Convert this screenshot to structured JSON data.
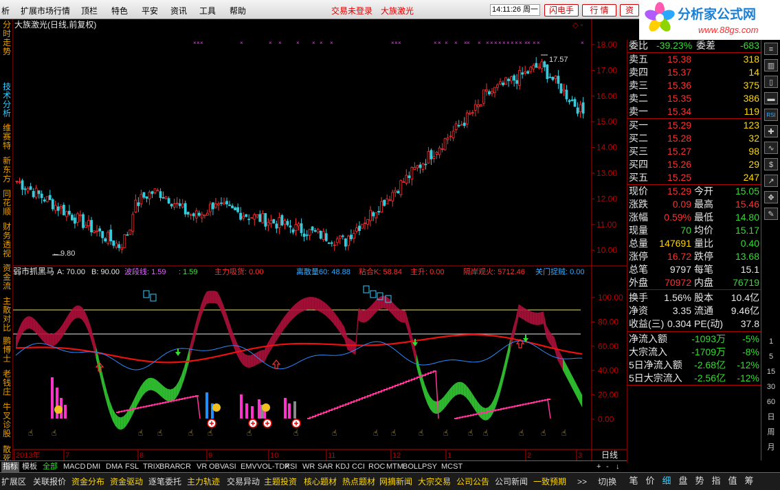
{
  "menu": {
    "items": [
      "析",
      "扩展市场行情",
      "顶栏",
      "特色",
      "平安",
      "资讯",
      "工具",
      "帮助"
    ],
    "status_left": "交易未登录",
    "status_right": "大族激光",
    "clock": "14:11:26 周一",
    "btn_flash": "闪电手",
    "btn_quote": "行 情",
    "btn_trade": "资"
  },
  "logo": {
    "title": "分析家公式网",
    "url": "www.88gs.com"
  },
  "left_tabs": [
    "分时走势",
    "技术分析",
    "维赛特",
    "新东方",
    "同花顺",
    "财务透视",
    "资金流",
    "主散对比",
    "鹏博士",
    "老钱庄",
    "牛叉诊股",
    "散死队"
  ],
  "chart": {
    "title": "大族激光(日线,前复权)",
    "max_label": "17.57",
    "min_label": "9.80",
    "price_ticks": [
      "18.00",
      "17.00",
      "16.00",
      "15.00",
      "14.00",
      "13.00",
      "12.00",
      "11.00",
      "10.00"
    ],
    "ind_ticks": [
      "100.00",
      "80.00",
      "60.00",
      "40.00",
      "20.00",
      "0.00"
    ],
    "dates": [
      "2013年",
      "7",
      "8",
      "9",
      "10",
      "11",
      "12",
      "1",
      "2",
      "3"
    ],
    "period": "日线",
    "ind_name": "弱市抓黑马",
    "ind_a": "A: 70.00",
    "ind_b": "B: 90.00",
    "ind_bd": "波段线: 1.59",
    "ind_v2": ": 1.59",
    "ind_zl": "主力吸货: 0.00",
    "ind_lsl": "离散量60: 48.88",
    "ind_nhk": "粘合K: 58.84",
    "ind_zs": "主升: 0.00",
    "ind_gag": "隔岸观火: 5712.46",
    "ind_gm": "关门捉贼: 0.00"
  },
  "quote": {
    "wb_label": "委比",
    "wb_val": "-39.23%",
    "wc_label": "委差",
    "wc_val": "-683",
    "asks": [
      {
        "label": "卖五",
        "price": "15.38",
        "vol": "318"
      },
      {
        "label": "卖四",
        "price": "15.37",
        "vol": "14"
      },
      {
        "label": "卖三",
        "price": "15.36",
        "vol": "375"
      },
      {
        "label": "卖二",
        "price": "15.35",
        "vol": "386"
      },
      {
        "label": "卖一",
        "price": "15.34",
        "vol": "119"
      }
    ],
    "bids": [
      {
        "label": "买一",
        "price": "15.29",
        "vol": "123"
      },
      {
        "label": "买二",
        "price": "15.28",
        "vol": "32"
      },
      {
        "label": "买三",
        "price": "15.27",
        "vol": "98"
      },
      {
        "label": "买四",
        "price": "15.26",
        "vol": "29"
      },
      {
        "label": "买五",
        "price": "15.25",
        "vol": "247"
      }
    ],
    "stats": [
      {
        "l1": "现价",
        "v1": "15.29",
        "c1": "#ff3030",
        "l2": "今开",
        "v2": "15.05",
        "c2": "#33dd33"
      },
      {
        "l1": "涨跌",
        "v1": "0.09",
        "c1": "#ff3030",
        "l2": "最高",
        "v2": "15.46",
        "c2": "#ff3030"
      },
      {
        "l1": "涨幅",
        "v1": "0.59%",
        "c1": "#ff3030",
        "l2": "最低",
        "v2": "14.80",
        "c2": "#33dd33"
      },
      {
        "l1": "现量",
        "v1": "70",
        "c1": "#33dd33",
        "l2": "均价",
        "v2": "15.17",
        "c2": "#33dd33"
      },
      {
        "l1": "总量",
        "v1": "147691",
        "c1": "#ffd800",
        "l2": "量比",
        "v2": "0.40",
        "c2": "#33dd33"
      },
      {
        "l1": "涨停",
        "v1": "16.72",
        "c1": "#ff3030",
        "l2": "跌停",
        "v2": "13.68",
        "c2": "#33dd33"
      },
      {
        "l1": "总笔",
        "v1": "9797",
        "c1": "#e8e8e8",
        "l2": "每笔",
        "v2": "15.1",
        "c2": "#e8e8e8"
      },
      {
        "l1": "外盘",
        "v1": "70972",
        "c1": "#ff3030",
        "l2": "内盘",
        "v2": "76719",
        "c2": "#33dd33"
      }
    ],
    "fund": [
      {
        "l1": "换手",
        "v1": "1.56%",
        "l2": "股本",
        "v2": "10.4亿"
      },
      {
        "l1": "净资",
        "v1": "3.35",
        "l2": "流通",
        "v2": "9.46亿"
      },
      {
        "l1": "收益(三)",
        "v1": "0.304",
        "l2": "PE(动)",
        "v2": "37.8"
      }
    ],
    "flows": [
      {
        "label": "净流入额",
        "val": "-1093万",
        "pct": "-5%"
      },
      {
        "label": "大宗流入",
        "val": "-1709万",
        "pct": "-8%"
      },
      {
        "label": "5日净流入额",
        "val": "-2.68亿",
        "pct": "-12%"
      },
      {
        "label": "5日大宗流入",
        "val": "-2.56亿",
        "pct": "-12%"
      }
    ]
  },
  "icons": [
    "lines-icon",
    "bars-icon",
    "candle-icon",
    "bars2-icon",
    "rsi-icon",
    "cross-icon",
    "wave-icon",
    "dollar-icon",
    "rise-icon",
    "move-icon",
    "pencil-icon"
  ],
  "icon_labels": [
    "1",
    "5",
    "15",
    "30",
    "60",
    "日",
    "周",
    "月"
  ],
  "tabs": [
    "指标",
    "模板",
    "全部",
    "MACD",
    "DMI",
    "DMA",
    "FSL",
    "TRIX",
    "BRAR",
    "CR",
    "VR",
    "OBV",
    "ASI",
    "EMV",
    "VOL-TDX",
    "RSI",
    "WR",
    "SAR",
    "KDJ",
    "CCI",
    "ROC",
    "MTM",
    "BOLL",
    "PSY",
    "MCST"
  ],
  "tab_tail": [
    "+",
    "-",
    "↓"
  ],
  "bottom": [
    "扩展区",
    "关联报价",
    "资金分布",
    "资金驱动",
    "逐笔委托",
    "主力轨迹",
    "交易异动",
    "主题投资",
    "核心题材",
    "热点题材",
    "网摘新闻",
    "大宗交易",
    "公司公告",
    "公司新闻",
    "一致预期",
    ">>",
    "切|换"
  ],
  "bottom_right": [
    "笔",
    "价",
    "细",
    "盘",
    "势",
    "指",
    "值",
    "筹"
  ]
}
